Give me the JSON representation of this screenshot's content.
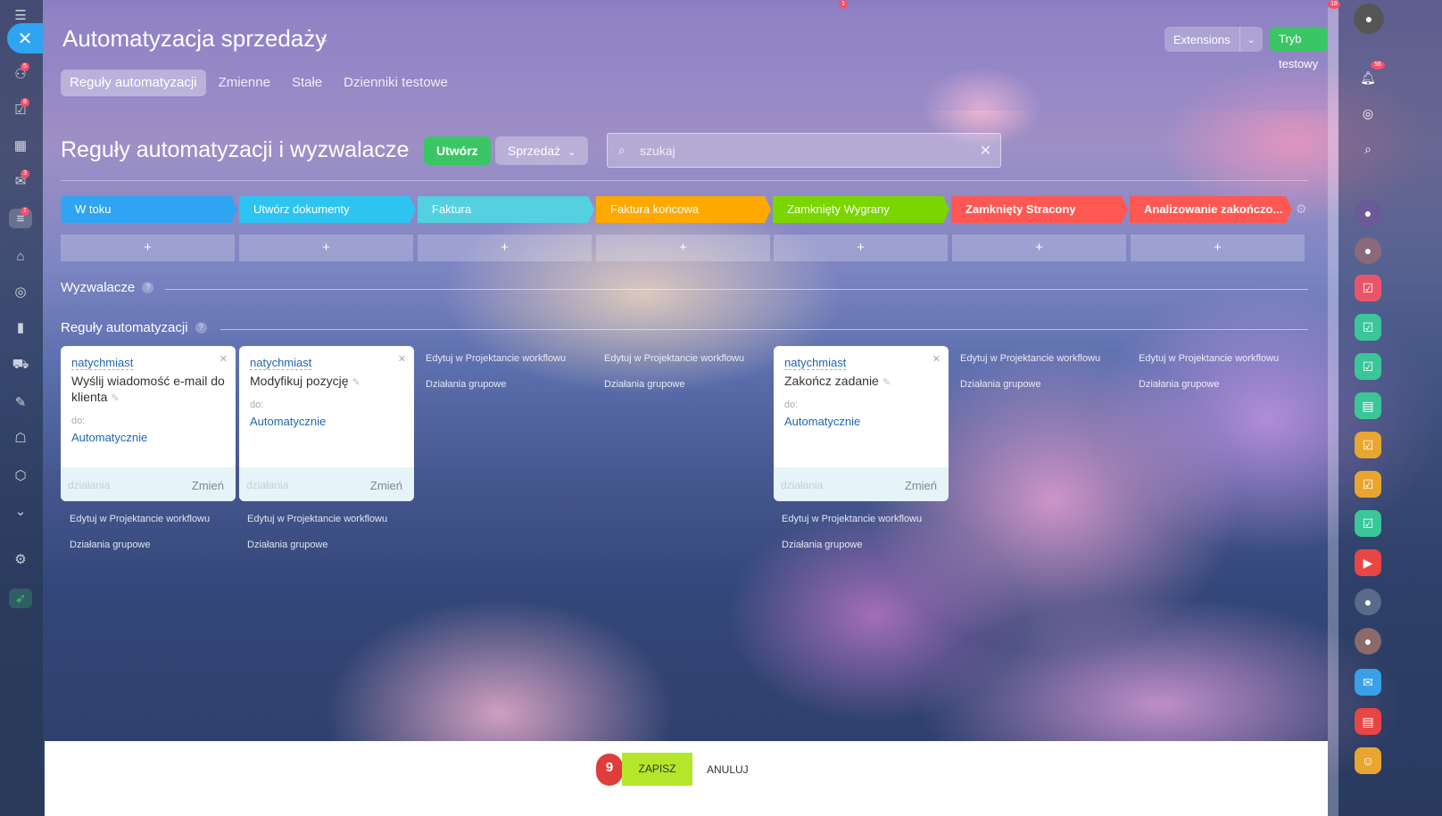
{
  "header": {
    "title": "Automatyzacja sprzedaży",
    "extensions_label": "Extensions",
    "test_mode_label": "Tryb testowy"
  },
  "tabs": [
    {
      "label": "Reguły automatyzacji",
      "active": true
    },
    {
      "label": "Zmienne",
      "active": false
    },
    {
      "label": "Stałe",
      "active": false
    },
    {
      "label": "Dzienniki testowe",
      "active": false
    }
  ],
  "toolbar": {
    "heading": "Reguły automatyzacji i wyzwalacze",
    "create_label": "Utwórz",
    "pipeline_label": "Sprzedaż",
    "search_placeholder": "szukaj"
  },
  "stages": [
    {
      "label": "W toku",
      "color": "#2fa4f2"
    },
    {
      "label": "Utwórz dokumenty",
      "color": "#2ec4f2"
    },
    {
      "label": "Faktura",
      "color": "#55d0e0"
    },
    {
      "label": "Faktura końcowa",
      "color": "#ffa900"
    },
    {
      "label": "Zamknięty Wygrany",
      "color": "#7bd500"
    },
    {
      "label": "Zamknięty Stracony",
      "color": "#ff5752"
    },
    {
      "label": "Analizowanie zakończo...",
      "color": "#ff5752"
    }
  ],
  "add_symbol": "+",
  "sections": {
    "triggers": "Wyzwalacze",
    "rules": "Reguły automatyzacji"
  },
  "cards": [
    {
      "condition": "natychmiast",
      "name": "Wyślij wiadomość e-mail do klienta",
      "to_label": "do:",
      "to_value": "Automatycznie",
      "actions_label": "działania",
      "change_label": "Zmień"
    },
    {
      "condition": "natychmiast",
      "name": "Modyfikuj pozycję",
      "to_label": "do:",
      "to_value": "Automatycznie",
      "actions_label": "działania",
      "change_label": "Zmień"
    },
    {
      "condition": "natychmiast",
      "name": "Zakończ zadanie",
      "to_label": "do:",
      "to_value": "Automatycznie",
      "actions_label": "działania",
      "change_label": "Zmień"
    }
  ],
  "column_links": {
    "edit": "Edytuj w Projektancie workflowu",
    "group": "Działania grupowe"
  },
  "left_badges": [
    "5",
    "8",
    "3",
    "1"
  ],
  "notification_count": "56",
  "top_badges": [
    "1",
    "18"
  ],
  "footer": {
    "counter": "9",
    "save_label": "ZAPISZ",
    "cancel_label": "ANULUJ"
  }
}
